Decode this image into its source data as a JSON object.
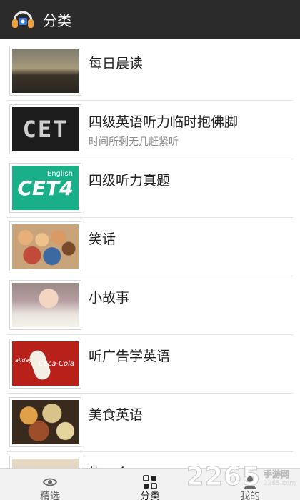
{
  "header": {
    "title": "分类",
    "app_icon": "headphones-icon"
  },
  "list": {
    "items": [
      {
        "title": "每日晨读",
        "subtitle": "",
        "thumb": "sunrise-thumb",
        "thumb_text": ""
      },
      {
        "title": "四级英语听力临时抱佛脚",
        "subtitle": "时间所剩无几赶紧听",
        "thumb": "cet-thumb",
        "thumb_text": "CET"
      },
      {
        "title": "四级听力真题",
        "subtitle": "",
        "thumb": "cet4-thumb",
        "thumb_text": "CET4",
        "thumb_text2": "English"
      },
      {
        "title": "笑话",
        "subtitle": "",
        "thumb": "comic-thumb",
        "thumb_text": ""
      },
      {
        "title": "小故事",
        "subtitle": "",
        "thumb": "story-thumb",
        "thumb_text": ""
      },
      {
        "title": "听广告学英语",
        "subtitle": "",
        "thumb": "ads-thumb",
        "thumb_text": "Coca-Cola",
        "thumb_text2": "alldays"
      },
      {
        "title": "美食英语",
        "subtitle": "",
        "thumb": "food-thumb",
        "thumb_text": ""
      },
      {
        "title": "绕口令",
        "subtitle": "",
        "thumb": "last-thumb",
        "thumb_text": ""
      }
    ]
  },
  "bottom_nav": {
    "items": [
      {
        "label": "精选",
        "icon": "eye-icon",
        "active": false
      },
      {
        "label": "分类",
        "icon": "category-grid-icon",
        "active": true
      },
      {
        "label": "我的",
        "icon": "user-icon",
        "active": false
      }
    ]
  },
  "watermark": {
    "number": "2265",
    "text": "手游网",
    "domain": "2265.com"
  }
}
